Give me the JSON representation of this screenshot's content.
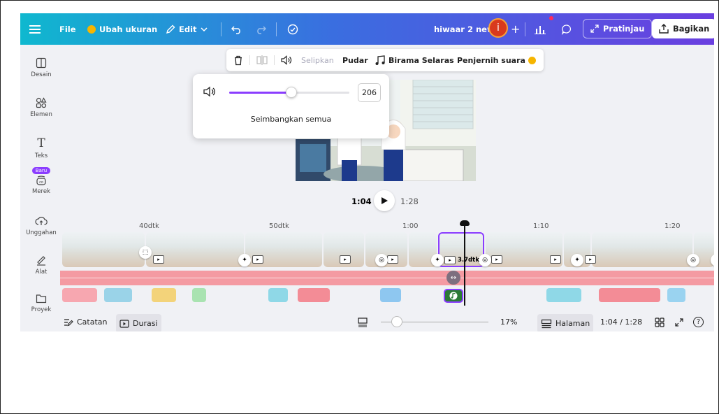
{
  "topbar": {
    "file_label": "File",
    "resize_label": "Ubah ukuran",
    "edit_label": "Edit",
    "project_title": "hiwaar 2 new",
    "avatar_letter": "i",
    "preview_label": "Pratinjau",
    "share_label": "Bagikan"
  },
  "sidebar": {
    "items": [
      {
        "label": "Desain"
      },
      {
        "label": "Elemen"
      },
      {
        "label": "Teks"
      },
      {
        "label": "Merek",
        "badge": "Baru"
      },
      {
        "label": "Unggahan"
      },
      {
        "label": "Alat"
      },
      {
        "label": "Proyek"
      }
    ]
  },
  "context_toolbar": {
    "insert_label": "Selipkan",
    "fade_label": "Pudar",
    "beat_sync_label": "Birama Selaras",
    "enhance_label": "Penjernih suara"
  },
  "volume_popup": {
    "value": "206",
    "level_fraction": 0.52,
    "balance_label": "Seimbangkan semua"
  },
  "playback": {
    "current_time": "1:04",
    "total_time": "1:28"
  },
  "timeline": {
    "ruler_labels": [
      "40dtk",
      "50dtk",
      "1:00",
      "1:10",
      "1:20"
    ],
    "selected_clip_duration": "3.7dtk"
  },
  "bottom_bar": {
    "notes_label": "Catatan",
    "duration_label": "Durasi",
    "zoom_percent": "17%",
    "pages_label": "Halaman",
    "time_readout": "1:04 / 1:28",
    "help_label": "?"
  },
  "colors": {
    "accent": "#8b3dff",
    "audio_track": "#f49aa2",
    "selected_audio": "#2c7a36"
  }
}
